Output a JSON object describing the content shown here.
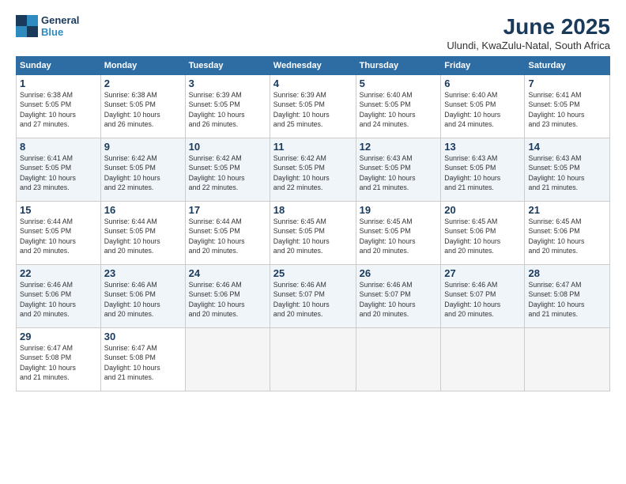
{
  "logo": {
    "line1": "General",
    "line2": "Blue"
  },
  "title": "June 2025",
  "subtitle": "Ulundi, KwaZulu-Natal, South Africa",
  "days_of_week": [
    "Sunday",
    "Monday",
    "Tuesday",
    "Wednesday",
    "Thursday",
    "Friday",
    "Saturday"
  ],
  "weeks": [
    [
      {
        "day": "1",
        "info": "Sunrise: 6:38 AM\nSunset: 5:05 PM\nDaylight: 10 hours\nand 27 minutes."
      },
      {
        "day": "2",
        "info": "Sunrise: 6:38 AM\nSunset: 5:05 PM\nDaylight: 10 hours\nand 26 minutes."
      },
      {
        "day": "3",
        "info": "Sunrise: 6:39 AM\nSunset: 5:05 PM\nDaylight: 10 hours\nand 26 minutes."
      },
      {
        "day": "4",
        "info": "Sunrise: 6:39 AM\nSunset: 5:05 PM\nDaylight: 10 hours\nand 25 minutes."
      },
      {
        "day": "5",
        "info": "Sunrise: 6:40 AM\nSunset: 5:05 PM\nDaylight: 10 hours\nand 24 minutes."
      },
      {
        "day": "6",
        "info": "Sunrise: 6:40 AM\nSunset: 5:05 PM\nDaylight: 10 hours\nand 24 minutes."
      },
      {
        "day": "7",
        "info": "Sunrise: 6:41 AM\nSunset: 5:05 PM\nDaylight: 10 hours\nand 23 minutes."
      }
    ],
    [
      {
        "day": "8",
        "info": "Sunrise: 6:41 AM\nSunset: 5:05 PM\nDaylight: 10 hours\nand 23 minutes."
      },
      {
        "day": "9",
        "info": "Sunrise: 6:42 AM\nSunset: 5:05 PM\nDaylight: 10 hours\nand 22 minutes."
      },
      {
        "day": "10",
        "info": "Sunrise: 6:42 AM\nSunset: 5:05 PM\nDaylight: 10 hours\nand 22 minutes."
      },
      {
        "day": "11",
        "info": "Sunrise: 6:42 AM\nSunset: 5:05 PM\nDaylight: 10 hours\nand 22 minutes."
      },
      {
        "day": "12",
        "info": "Sunrise: 6:43 AM\nSunset: 5:05 PM\nDaylight: 10 hours\nand 21 minutes."
      },
      {
        "day": "13",
        "info": "Sunrise: 6:43 AM\nSunset: 5:05 PM\nDaylight: 10 hours\nand 21 minutes."
      },
      {
        "day": "14",
        "info": "Sunrise: 6:43 AM\nSunset: 5:05 PM\nDaylight: 10 hours\nand 21 minutes."
      }
    ],
    [
      {
        "day": "15",
        "info": "Sunrise: 6:44 AM\nSunset: 5:05 PM\nDaylight: 10 hours\nand 20 minutes."
      },
      {
        "day": "16",
        "info": "Sunrise: 6:44 AM\nSunset: 5:05 PM\nDaylight: 10 hours\nand 20 minutes."
      },
      {
        "day": "17",
        "info": "Sunrise: 6:44 AM\nSunset: 5:05 PM\nDaylight: 10 hours\nand 20 minutes."
      },
      {
        "day": "18",
        "info": "Sunrise: 6:45 AM\nSunset: 5:05 PM\nDaylight: 10 hours\nand 20 minutes."
      },
      {
        "day": "19",
        "info": "Sunrise: 6:45 AM\nSunset: 5:05 PM\nDaylight: 10 hours\nand 20 minutes."
      },
      {
        "day": "20",
        "info": "Sunrise: 6:45 AM\nSunset: 5:06 PM\nDaylight: 10 hours\nand 20 minutes."
      },
      {
        "day": "21",
        "info": "Sunrise: 6:45 AM\nSunset: 5:06 PM\nDaylight: 10 hours\nand 20 minutes."
      }
    ],
    [
      {
        "day": "22",
        "info": "Sunrise: 6:46 AM\nSunset: 5:06 PM\nDaylight: 10 hours\nand 20 minutes."
      },
      {
        "day": "23",
        "info": "Sunrise: 6:46 AM\nSunset: 5:06 PM\nDaylight: 10 hours\nand 20 minutes."
      },
      {
        "day": "24",
        "info": "Sunrise: 6:46 AM\nSunset: 5:06 PM\nDaylight: 10 hours\nand 20 minutes."
      },
      {
        "day": "25",
        "info": "Sunrise: 6:46 AM\nSunset: 5:07 PM\nDaylight: 10 hours\nand 20 minutes."
      },
      {
        "day": "26",
        "info": "Sunrise: 6:46 AM\nSunset: 5:07 PM\nDaylight: 10 hours\nand 20 minutes."
      },
      {
        "day": "27",
        "info": "Sunrise: 6:46 AM\nSunset: 5:07 PM\nDaylight: 10 hours\nand 20 minutes."
      },
      {
        "day": "28",
        "info": "Sunrise: 6:47 AM\nSunset: 5:08 PM\nDaylight: 10 hours\nand 21 minutes."
      }
    ],
    [
      {
        "day": "29",
        "info": "Sunrise: 6:47 AM\nSunset: 5:08 PM\nDaylight: 10 hours\nand 21 minutes."
      },
      {
        "day": "30",
        "info": "Sunrise: 6:47 AM\nSunset: 5:08 PM\nDaylight: 10 hours\nand 21 minutes."
      },
      {
        "day": "",
        "info": ""
      },
      {
        "day": "",
        "info": ""
      },
      {
        "day": "",
        "info": ""
      },
      {
        "day": "",
        "info": ""
      },
      {
        "day": "",
        "info": ""
      }
    ]
  ]
}
